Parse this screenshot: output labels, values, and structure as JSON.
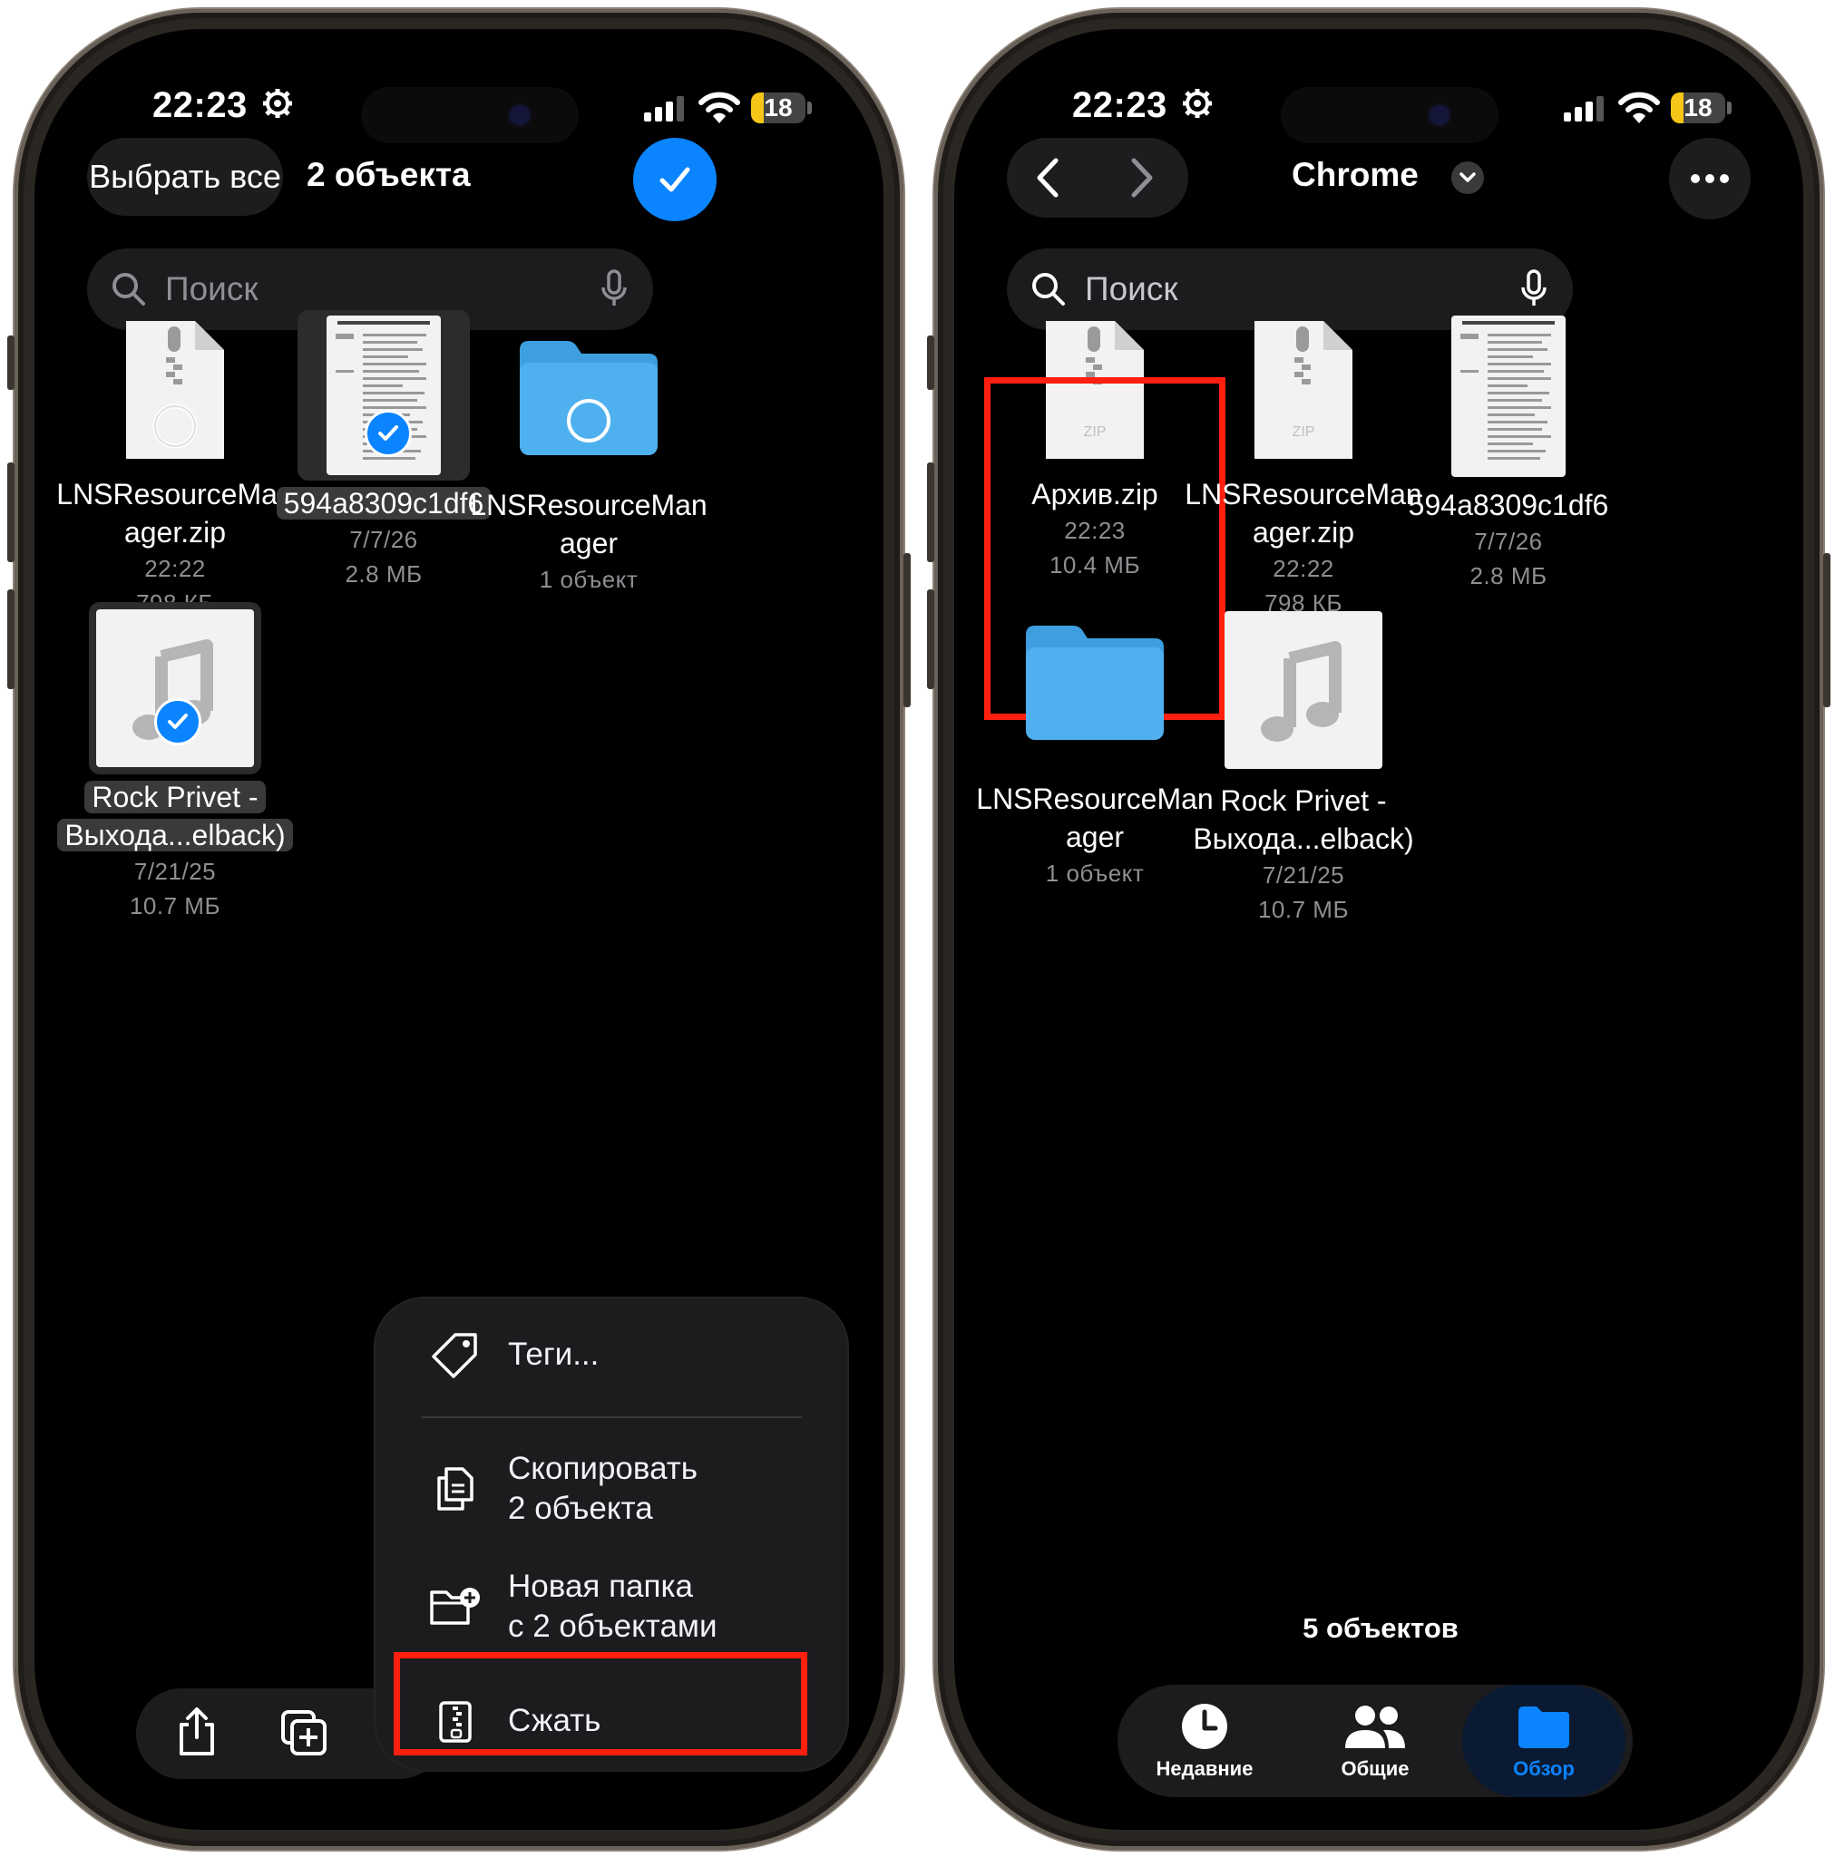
{
  "status": {
    "time": "22:23",
    "battery": "18"
  },
  "left": {
    "select_all": "Выбрать все",
    "count": "2 объекта",
    "search_placeholder": "Поиск",
    "files": [
      {
        "name": "LNSResourceMan ager.zip",
        "line1": "LNSResourceMan",
        "line2": "ager.zip",
        "meta1": "22:22",
        "meta2": "798 КБ",
        "selected": false
      },
      {
        "name": "594a8309c1df6",
        "line1": "594a8309c1df6",
        "meta1": "7/7/26",
        "meta2": "2.8 МБ",
        "selected": true
      },
      {
        "name": "LNSResourceMan ager",
        "line1": "LNSResourceMan",
        "line2": "ager",
        "meta1": "1 объект",
        "selected": false
      },
      {
        "name": "Rock Privet - Выхода...elback)",
        "line1": "Rock Privet -",
        "line2": "Выхода...elback)",
        "meta1": "7/21/25",
        "meta2": "10.7 МБ",
        "selected": true
      }
    ],
    "menu": {
      "tags": "Теги...",
      "copy_line1": "Скопировать",
      "copy_line2": "2 объекта",
      "newfolder_line1": "Новая папка",
      "newfolder_line2": "с 2 объектами",
      "compress": "Сжать"
    }
  },
  "right": {
    "title": "Chrome",
    "search_placeholder": "Поиск",
    "files": [
      {
        "line1": "Архив.zip",
        "meta1": "22:23",
        "meta2": "10.4 МБ"
      },
      {
        "line1": "LNSResourceMan",
        "line2": "ager.zip",
        "meta1": "22:22",
        "meta2": "798 КБ"
      },
      {
        "line1": "594a8309c1df6",
        "meta1": "7/7/26",
        "meta2": "2.8 МБ"
      },
      {
        "line1": "LNSResourceMan",
        "line2": "ager",
        "meta1": "1 объект"
      },
      {
        "line1": "Rock Privet -",
        "line2": "Выхода...elback)",
        "meta1": "7/21/25",
        "meta2": "10.7 МБ"
      }
    ],
    "footer_count": "5 объектов",
    "tabs": [
      {
        "label": "Недавние"
      },
      {
        "label": "Общие"
      },
      {
        "label": "Обзор",
        "active": true
      }
    ],
    "zip_badge": "ZIP"
  },
  "colors": {
    "accent": "#0a84ff",
    "highlight": "#ff1f0f",
    "folder": "#4fb0ef"
  }
}
